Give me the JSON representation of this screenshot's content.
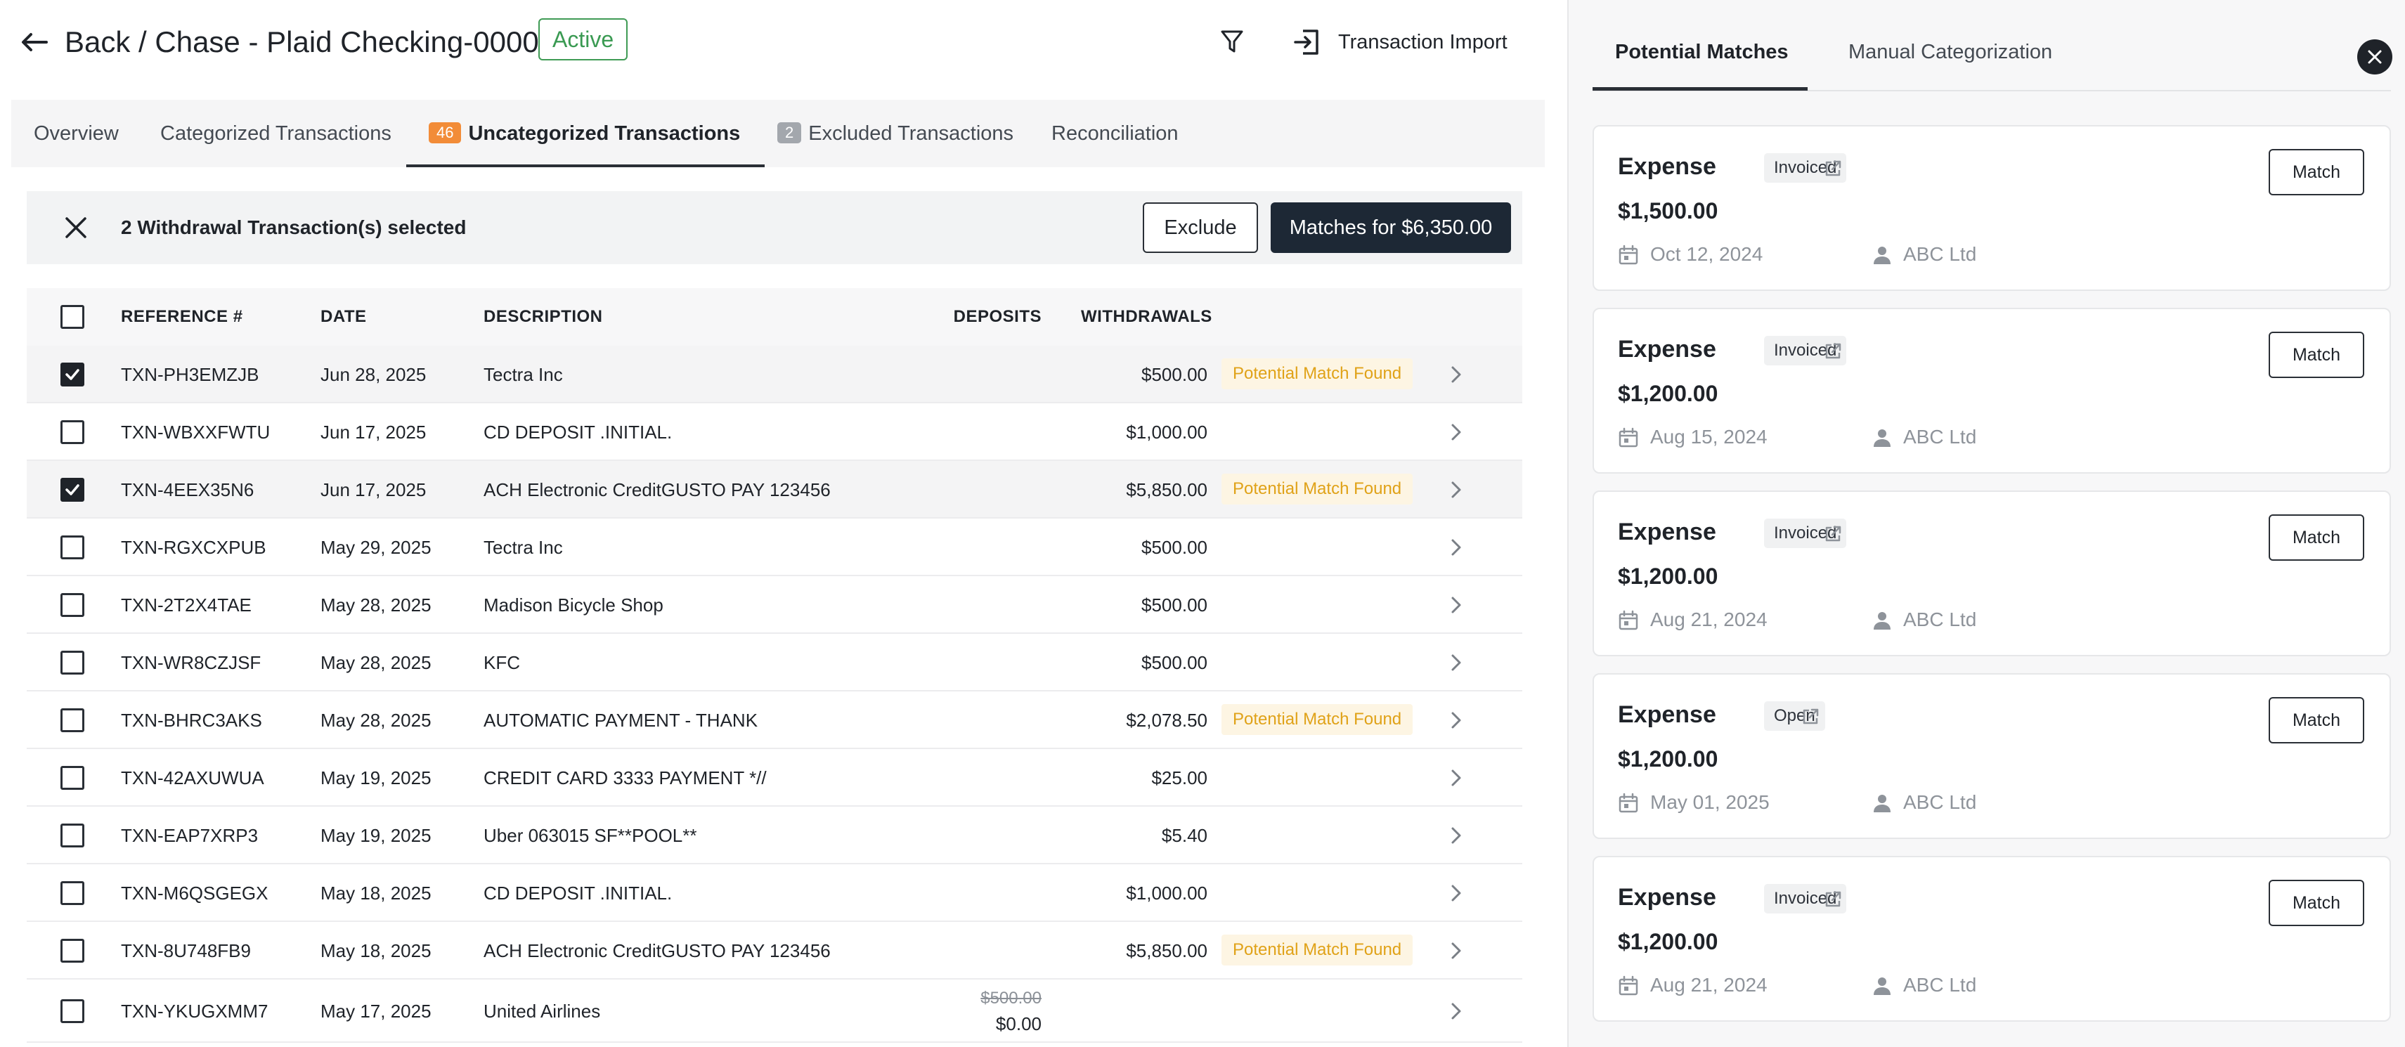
{
  "header": {
    "title": "Back / Chase - Plaid Checking-0000",
    "status": "Active",
    "import_label": "Transaction Import"
  },
  "tabs": [
    {
      "label": "Overview"
    },
    {
      "label": "Categorized Transactions"
    },
    {
      "label": "Uncategorized Transactions",
      "count": "46"
    },
    {
      "label": "Excluded Transactions",
      "count": "2"
    },
    {
      "label": "Reconciliation"
    }
  ],
  "selection": {
    "text": "2 Withdrawal Transaction(s) selected",
    "exclude_label": "Exclude",
    "matches_label": "Matches for $6,350.00"
  },
  "table": {
    "columns": {
      "reference": "REFERENCE #",
      "date": "DATE",
      "description": "DESCRIPTION",
      "deposits": "DEPOSITS",
      "withdrawals": "WITHDRAWALS"
    },
    "rows": [
      {
        "checked": true,
        "ref": "TXN-PH3EMZJB",
        "date": "Jun 28, 2025",
        "desc": "Tectra Inc",
        "deposit": "",
        "withdrawal": "$500.00",
        "badge": "Potential Match Found"
      },
      {
        "checked": false,
        "ref": "TXN-WBXXFWTU",
        "date": "Jun 17, 2025",
        "desc": "CD DEPOSIT .INITIAL.",
        "deposit": "",
        "withdrawal": "$1,000.00",
        "badge": ""
      },
      {
        "checked": true,
        "ref": "TXN-4EEX35N6",
        "date": "Jun 17, 2025",
        "desc": "ACH Electronic CreditGUSTO PAY 123456",
        "deposit": "",
        "withdrawal": "$5,850.00",
        "badge": "Potential Match Found"
      },
      {
        "checked": false,
        "ref": "TXN-RGXCXPUB",
        "date": "May 29, 2025",
        "desc": "Tectra Inc",
        "deposit": "",
        "withdrawal": "$500.00",
        "badge": ""
      },
      {
        "checked": false,
        "ref": "TXN-2T2X4TAE",
        "date": "May 28, 2025",
        "desc": "Madison Bicycle Shop",
        "deposit": "",
        "withdrawal": "$500.00",
        "badge": ""
      },
      {
        "checked": false,
        "ref": "TXN-WR8CZJSF",
        "date": "May 28, 2025",
        "desc": "KFC",
        "deposit": "",
        "withdrawal": "$500.00",
        "badge": ""
      },
      {
        "checked": false,
        "ref": "TXN-BHRC3AKS",
        "date": "May 28, 2025",
        "desc": "AUTOMATIC PAYMENT - THANK",
        "deposit": "",
        "withdrawal": "$2,078.50",
        "badge": "Potential Match Found"
      },
      {
        "checked": false,
        "ref": "TXN-42AXUWUA",
        "date": "May 19, 2025",
        "desc": "CREDIT CARD 3333 PAYMENT *//",
        "deposit": "",
        "withdrawal": "$25.00",
        "badge": ""
      },
      {
        "checked": false,
        "ref": "TXN-EAP7XRP3",
        "date": "May 19, 2025",
        "desc": "Uber 063015 SF**POOL**",
        "deposit": "",
        "withdrawal": "$5.40",
        "badge": ""
      },
      {
        "checked": false,
        "ref": "TXN-M6QSGEGX",
        "date": "May 18, 2025",
        "desc": "CD DEPOSIT .INITIAL.",
        "deposit": "",
        "withdrawal": "$1,000.00",
        "badge": ""
      },
      {
        "checked": false,
        "ref": "TXN-8U748FB9",
        "date": "May 18, 2025",
        "desc": "ACH Electronic CreditGUSTO PAY 123456",
        "deposit": "",
        "withdrawal": "$5,850.00",
        "badge": "Potential Match Found"
      },
      {
        "checked": false,
        "ref": "TXN-YKUGXMM7",
        "date": "May 17, 2025",
        "desc": "United Airlines",
        "deposit_old": "$500.00",
        "deposit": "$0.00",
        "withdrawal": "",
        "badge": ""
      }
    ]
  },
  "panel": {
    "tabs": [
      "Potential Matches",
      "Manual Categorization"
    ],
    "match_label": "Match",
    "cards": [
      {
        "type": "Expense",
        "status": "Invoiced",
        "amount": "$1,500.00",
        "date": "Oct 12, 2024",
        "vendor": "ABC Ltd"
      },
      {
        "type": "Expense",
        "status": "Invoiced",
        "amount": "$1,200.00",
        "date": "Aug 15, 2024",
        "vendor": "ABC Ltd"
      },
      {
        "type": "Expense",
        "status": "Invoiced",
        "amount": "$1,200.00",
        "date": "Aug 21, 2024",
        "vendor": "ABC Ltd"
      },
      {
        "type": "Expense",
        "status": "Open",
        "amount": "$1,200.00",
        "date": "May 01, 2025",
        "vendor": "ABC Ltd"
      },
      {
        "type": "Expense",
        "status": "Invoiced",
        "amount": "$1,200.00",
        "date": "Aug 21, 2024",
        "vendor": "ABC Ltd"
      }
    ]
  },
  "colors": {
    "active_green": "#3a9a52",
    "orange_count": "#f28c38",
    "match_badge_text": "#e0a218",
    "primary_dark": "#1d2835"
  },
  "icons": {
    "back": "arrow-left-icon",
    "filter": "filter-icon",
    "import": "import-icon",
    "close": "close-icon",
    "chevron": "chevron-right-icon",
    "external": "external-link-icon",
    "calendar": "calendar-icon",
    "user": "user-icon"
  }
}
